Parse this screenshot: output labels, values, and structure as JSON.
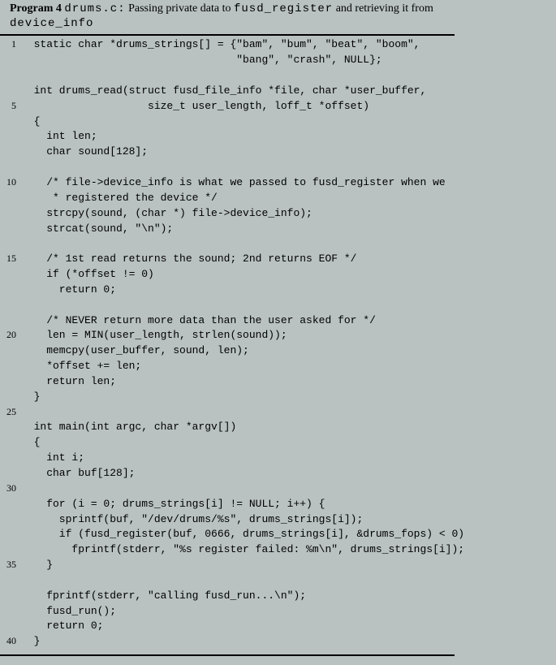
{
  "header": {
    "label": "Program 4",
    "filename": "drums.c:",
    "desc_before": "Passing private data to ",
    "code1": "fusd_register",
    "desc_mid": " and retrieving it from",
    "code2": "device_info"
  },
  "code": {
    "lines": [
      {
        "n": "1",
        "t": "  static char *drums_strings[] = {\"bam\", \"bum\", \"beat\", \"boom\","
      },
      {
        "n": "",
        "t": "                                  \"bang\", \"crash\", NULL};"
      },
      {
        "n": "",
        "t": "  "
      },
      {
        "n": "",
        "t": "  int drums_read(struct fusd_file_info *file, char *user_buffer,"
      },
      {
        "n": "5",
        "t": "                    size_t user_length, loff_t *offset)"
      },
      {
        "n": "",
        "t": "  {"
      },
      {
        "n": "",
        "t": "    int len;"
      },
      {
        "n": "",
        "t": "    char sound[128];"
      },
      {
        "n": "",
        "t": "  "
      },
      {
        "n": "10",
        "t": "    /* file->device_info is what we passed to fusd_register when we"
      },
      {
        "n": "",
        "t": "     * registered the device */"
      },
      {
        "n": "",
        "t": "    strcpy(sound, (char *) file->device_info);"
      },
      {
        "n": "",
        "t": "    strcat(sound, \"\\n\");"
      },
      {
        "n": "",
        "t": "  "
      },
      {
        "n": "15",
        "t": "    /* 1st read returns the sound; 2nd returns EOF */"
      },
      {
        "n": "",
        "t": "    if (*offset != 0)"
      },
      {
        "n": "",
        "t": "      return 0;"
      },
      {
        "n": "",
        "t": "  "
      },
      {
        "n": "",
        "t": "    /* NEVER return more data than the user asked for */"
      },
      {
        "n": "20",
        "t": "    len = MIN(user_length, strlen(sound));"
      },
      {
        "n": "",
        "t": "    memcpy(user_buffer, sound, len);"
      },
      {
        "n": "",
        "t": "    *offset += len;"
      },
      {
        "n": "",
        "t": "    return len;"
      },
      {
        "n": "",
        "t": "  }"
      },
      {
        "n": "25",
        "t": "  "
      },
      {
        "n": "",
        "t": "  int main(int argc, char *argv[])"
      },
      {
        "n": "",
        "t": "  {"
      },
      {
        "n": "",
        "t": "    int i;"
      },
      {
        "n": "",
        "t": "    char buf[128];"
      },
      {
        "n": "30",
        "t": "  "
      },
      {
        "n": "",
        "t": "    for (i = 0; drums_strings[i] != NULL; i++) {"
      },
      {
        "n": "",
        "t": "      sprintf(buf, \"/dev/drums/%s\", drums_strings[i]);"
      },
      {
        "n": "",
        "t": "      if (fusd_register(buf, 0666, drums_strings[i], &drums_fops) < 0)"
      },
      {
        "n": "",
        "t": "        fprintf(stderr, \"%s register failed: %m\\n\", drums_strings[i]);"
      },
      {
        "n": "35",
        "t": "    }"
      },
      {
        "n": "",
        "t": "  "
      },
      {
        "n": "",
        "t": "    fprintf(stderr, \"calling fusd_run...\\n\");"
      },
      {
        "n": "",
        "t": "    fusd_run();"
      },
      {
        "n": "",
        "t": "    return 0;"
      },
      {
        "n": "40",
        "t": "  }"
      }
    ]
  }
}
